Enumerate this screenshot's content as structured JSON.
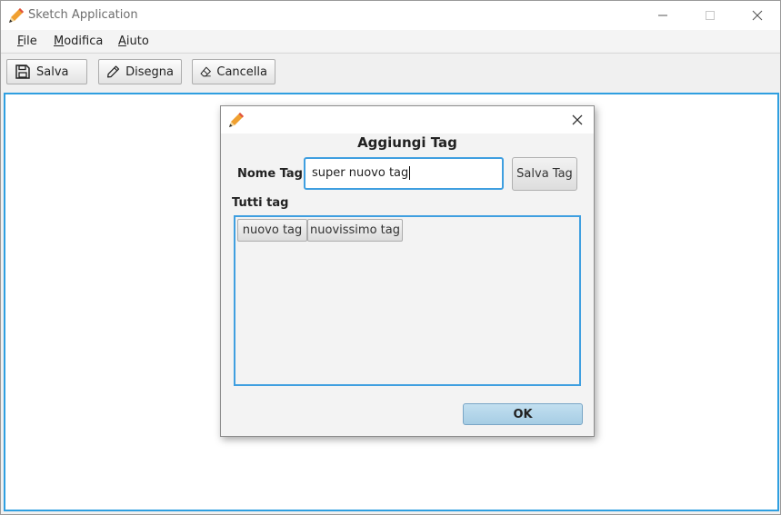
{
  "app": {
    "title": "Sketch Application",
    "icon": "pencil-icon"
  },
  "menubar": {
    "items": [
      {
        "mnemonic": "F",
        "rest": "ile"
      },
      {
        "mnemonic": "M",
        "rest": "odifica"
      },
      {
        "mnemonic": "A",
        "rest": "iuto"
      }
    ]
  },
  "toolbar": {
    "save_label": "Salva",
    "draw_label": "Disegna",
    "erase_label": "Cancella"
  },
  "dialog": {
    "heading": "Aggiungi Tag",
    "name_label": "Nome Tag",
    "name_value": "super nuovo tag",
    "save_tag_label": "Salva Tag",
    "all_tags_label": "Tutti tag",
    "tags": [
      "nuovo tag",
      "nuovissimo tag"
    ],
    "ok_label": "OK"
  },
  "colors": {
    "accent": "#2f9fe0",
    "ok_button": "#b5d8ec"
  }
}
